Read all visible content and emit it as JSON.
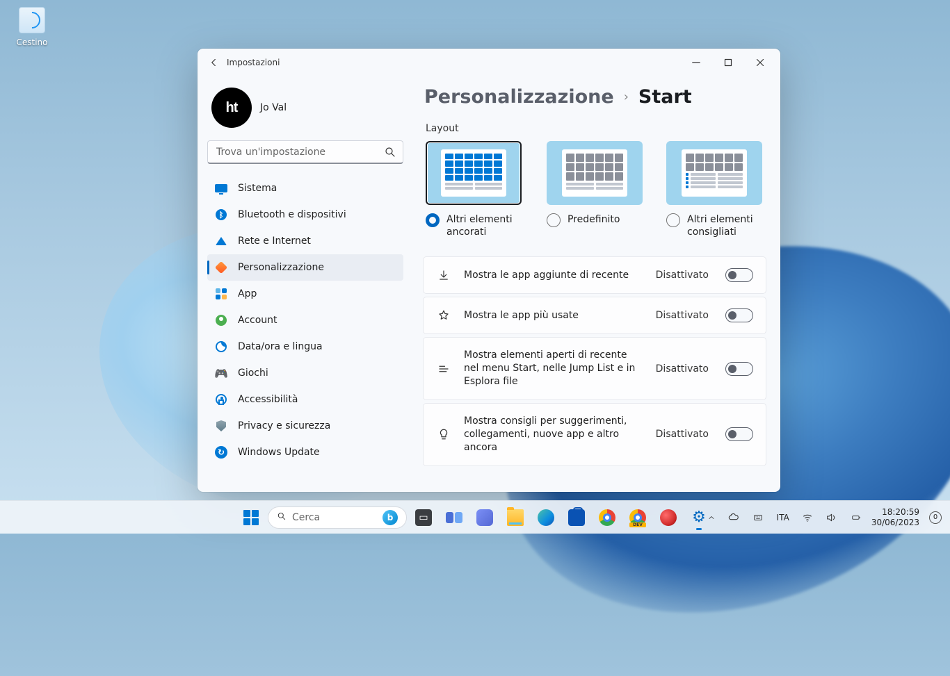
{
  "desktop": {
    "recycle_bin": "Cestino"
  },
  "window": {
    "title": "Impostazioni",
    "user_name": "Jo Val",
    "search_placeholder": "Trova un'impostazione"
  },
  "nav": {
    "system": "Sistema",
    "bluetooth": "Bluetooth e dispositivi",
    "network": "Rete e Internet",
    "personalization": "Personalizzazione",
    "apps": "App",
    "accounts": "Account",
    "time": "Data/ora e lingua",
    "gaming": "Giochi",
    "accessibility": "Accessibilità",
    "privacy": "Privacy e sicurezza",
    "update": "Windows Update"
  },
  "breadcrumb": {
    "parent": "Personalizzazione",
    "current": "Start"
  },
  "layout": {
    "section": "Layout",
    "opt1": "Altri elementi ancorati",
    "opt2": "Predefinito",
    "opt3": "Altri elementi consigliati"
  },
  "settings": {
    "recent_apps": {
      "label": "Mostra le app aggiunte di recente",
      "state": "Disattivato"
    },
    "most_used": {
      "label": "Mostra le app più usate",
      "state": "Disattivato"
    },
    "recent_items": {
      "label": "Mostra elementi aperti di recente nel menu Start, nelle Jump List e in Esplora file",
      "state": "Disattivato"
    },
    "tips": {
      "label": "Mostra consigli per suggerimenti, collegamenti, nuove app e altro ancora",
      "state": "Disattivato"
    }
  },
  "taskbar": {
    "search": "Cerca",
    "lang": "ITA",
    "time": "18:20:59",
    "date": "30/06/2023",
    "notif": "0"
  }
}
